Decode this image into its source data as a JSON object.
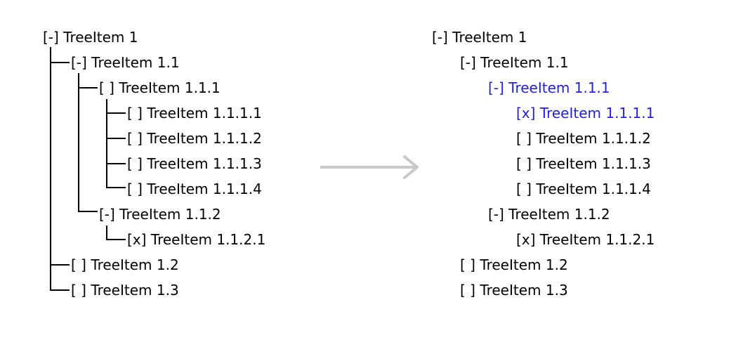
{
  "colors": {
    "text": "#000000",
    "highlight": "#1f1fe6",
    "arrow": "#c8c8c8"
  },
  "left_tree": [
    {
      "id": "n1",
      "text": "[-] TreeItem 1"
    },
    {
      "id": "n11",
      "text": "[-] TreeItem 1.1"
    },
    {
      "id": "n111",
      "text": "[ ] TreeItem 1.1.1"
    },
    {
      "id": "n1111",
      "text": "[ ] TreeItem 1.1.1.1"
    },
    {
      "id": "n1112",
      "text": "[ ] TreeItem 1.1.1.2"
    },
    {
      "id": "n1113",
      "text": "[ ] TreeItem 1.1.1.3"
    },
    {
      "id": "n1114",
      "text": "[ ] TreeItem 1.1.1.4"
    },
    {
      "id": "n112",
      "text": "[-] TreeItem 1.1.2"
    },
    {
      "id": "n1121",
      "text": "[x] TreeItem 1.1.2.1"
    },
    {
      "id": "n12",
      "text": "[ ] TreeItem 1.2"
    },
    {
      "id": "n13",
      "text": "[ ] TreeItem 1.3"
    }
  ],
  "right_tree": [
    {
      "id": "n1",
      "text": "[-] TreeItem 1"
    },
    {
      "id": "n11",
      "text": "[-] TreeItem 1.1"
    },
    {
      "id": "n111",
      "text": "[-] TreeItem 1.1.1",
      "highlight": true
    },
    {
      "id": "n1111",
      "text": "[x] TreeItem 1.1.1.1",
      "highlight": true
    },
    {
      "id": "n1112",
      "text": "[ ] TreeItem 1.1.1.2"
    },
    {
      "id": "n1113",
      "text": "[ ] TreeItem 1.1.1.3"
    },
    {
      "id": "n1114",
      "text": "[ ] TreeItem 1.1.1.4"
    },
    {
      "id": "n112",
      "text": "[-] TreeItem 1.1.2"
    },
    {
      "id": "n1121",
      "text": "[x] TreeItem 1.1.2.1"
    },
    {
      "id": "n12",
      "text": "[ ] TreeItem 1.2"
    },
    {
      "id": "n13",
      "text": "[ ] TreeItem 1.3"
    }
  ]
}
